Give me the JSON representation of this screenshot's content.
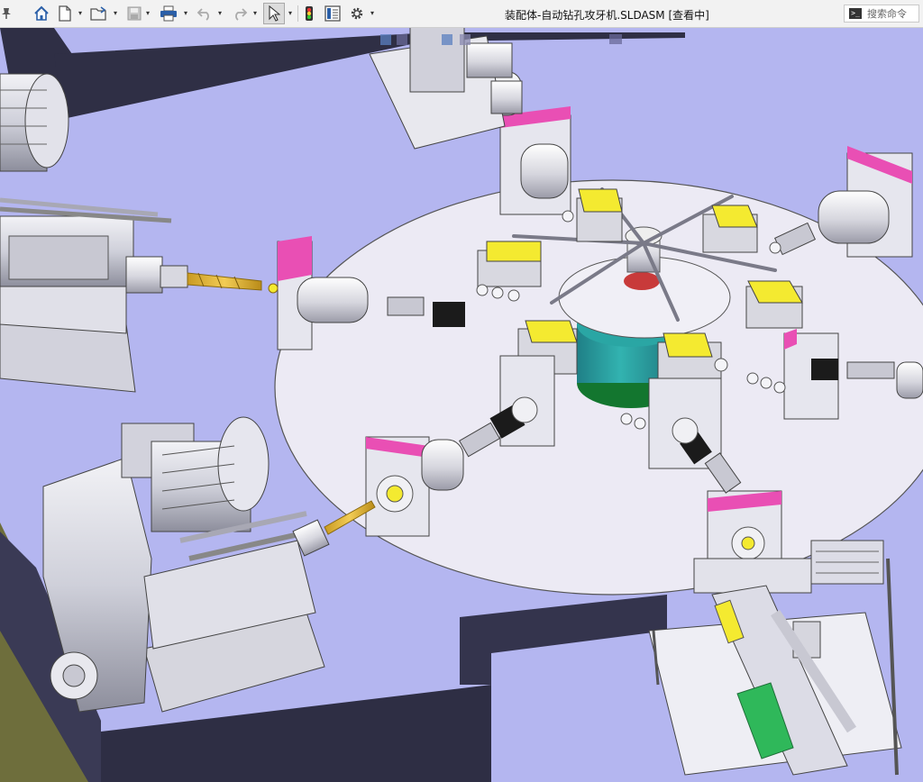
{
  "window": {
    "title": "装配体-自动钻孔攻牙机.SLDASM [查看中]"
  },
  "search": {
    "placeholder": "搜索命令",
    "icon": "command-prompt-icon"
  },
  "toolbar": {
    "pin_icon": "pin-icon",
    "home_icon": "home-icon",
    "new_icon": "new-document-icon",
    "open_icon": "open-folder-icon",
    "save_icon": "save-icon",
    "print_icon": "print-icon",
    "undo_icon": "undo-icon",
    "redo_icon": "redo-icon",
    "select_icon": "select-arrow-icon",
    "rebuild_icon": "traffic-light-icon",
    "file_properties_icon": "file-properties-icon",
    "options_icon": "gear-icon",
    "dropdown_glyph": "▾"
  },
  "colors": {
    "viewport_background": "#b4b6f0",
    "turntable": "#eceaf4",
    "part_gray": "#d8d8e0",
    "accent_magenta": "#e94fb4",
    "accent_yellow": "#f4ea30",
    "teal": "#2aa6a4",
    "green": "#2fb85a",
    "frame_dark": "#2f2f45",
    "floor_olive": "#6e6e3c"
  }
}
